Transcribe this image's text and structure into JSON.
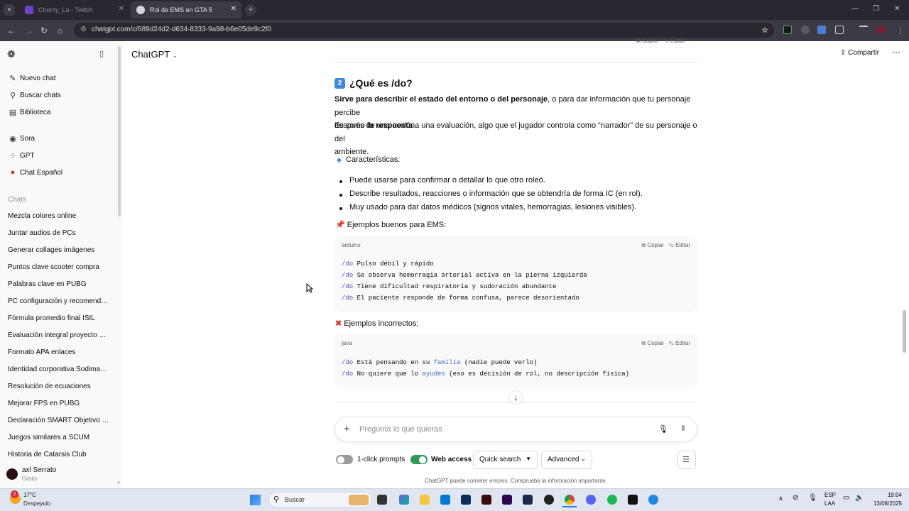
{
  "browser": {
    "tabs": [
      {
        "title": "Chomy_Lu - Twitch"
      },
      {
        "title": "Rol de EMS en GTA 5"
      }
    ],
    "url": "chatgpt.com/c/689d24d2-d634-8333-9a98-b6e05de9c2f0"
  },
  "sidebar": {
    "top_items": [
      {
        "label": "Nuevo chat",
        "icon": "edit-icon"
      },
      {
        "label": "Buscar chats",
        "icon": "search-icon"
      },
      {
        "label": "Biblioteca",
        "icon": "library-icon"
      }
    ],
    "apps": [
      {
        "label": "Sora",
        "icon": "sora-icon"
      },
      {
        "label": "GPT",
        "icon": "grid-icon"
      },
      {
        "label": "Chat Español",
        "icon": "gpt-avatar-icon"
      }
    ],
    "chats_heading": "Chats",
    "chats": [
      "Mezcla colores online",
      "Juntar audios de PCs",
      "Generar collages imágenes",
      "Puntos clave scooter compra",
      "Palabras clave en PUBG",
      "PC configuración y recomendaci...",
      "Fórmula promedio final ISIL",
      "Evaluación integral proyecto mo...",
      "Formato APA enlaces",
      "Identidad corporativa Sodimac P...",
      "Resolución de ecuaciones",
      "Mejorar FPS en PUBG",
      "Declaración SMART Objetivo Em...",
      "Juegos similares a SCUM",
      "Historia de Catarsis Club"
    ],
    "user": {
      "name": "axl Serrato",
      "plan": "Gratis"
    }
  },
  "header": {
    "model": "ChatGPT",
    "share": "Compartir"
  },
  "content": {
    "top_actions": {
      "copy": "Copiar",
      "edit": "Editar"
    },
    "heading_num": "2",
    "heading": "¿Qué es /do?",
    "p1_bold": "Sirve para describir el estado del entorno o del personaje",
    "p1_rest": ", o para dar información que tu personaje percibe",
    "p1_line2": "después de una acción.",
    "p2_pre": "Es como ",
    "p2_bold": "la respuesta",
    "p2_rest": " a una evaluación, algo que el jugador controla como “narrador” de su personaje o del",
    "p2_line2": "ambiente.",
    "features_label": "Características:",
    "features": [
      "Puede usarse para confirmar o detallar lo que otro roleó.",
      "Describe resultados, reacciones o información que se obtendría de forma IC (en rol).",
      "Muy usado para dar datos médicos (signos vitales, hemorragias, lesiones visibles)."
    ],
    "good_label": "Ejemplos buenos para EMS:",
    "good_code": {
      "lang": "arduino",
      "copy": "Copiar",
      "edit": "Editar",
      "lines": [
        {
          "kw": "/do",
          "text": " Pulso débil y rápido"
        },
        {
          "kw": "/do",
          "text": " Se observa hemorragia arterial activa en la pierna izquierda"
        },
        {
          "kw": "/do",
          "text": " Tiene dificultad respiratoria y sudoración abundante"
        },
        {
          "kw": "/do",
          "text": " El paciente responde de forma confusa, parece desorientado"
        }
      ]
    },
    "bad_label": "Ejemplos incorrectos:",
    "bad_code": {
      "lang": "java",
      "copy": "Copiar",
      "edit": "Editar",
      "line1": {
        "kw": "/do",
        "a": " Está pensando en su ",
        "hl": "familia",
        "b": " (nadie puede verlo)"
      },
      "line2": {
        "kw": "/do",
        "a": " No quiere que lo ",
        "hl": "ayudes",
        "b": " (eso es decisión de rol, no descripción física)"
      }
    }
  },
  "composer": {
    "placeholder": "Pregunta lo que quieras",
    "one_click": "1-click prompts",
    "web_access": "Web access",
    "search_mode": "Quick search",
    "advanced": "Advanced",
    "disclaimer": "ChatGPT puede cometer errores. Comprueba la información importante."
  },
  "taskbar": {
    "weather_temp": "17°C",
    "weather_desc": "Despejado",
    "weather_badge": "2",
    "search": "Buscar",
    "lang": "ESP",
    "lang2": "LAA",
    "time": "19:04",
    "date": "13/08/2025"
  },
  "colors": {
    "accent_toggle": "#2e9b57",
    "link_blue": "#3a6fc4",
    "keyword": "#5b4bb8"
  }
}
